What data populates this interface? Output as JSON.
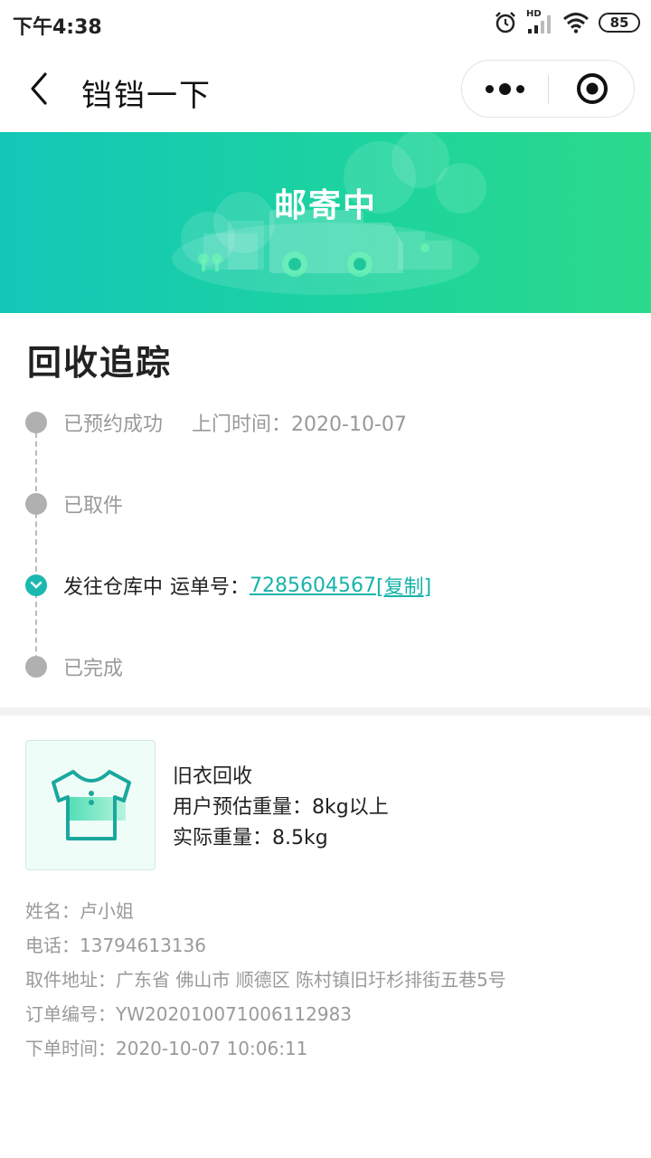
{
  "status": {
    "time": "下午4:38",
    "network": "HD",
    "battery": "85"
  },
  "nav": {
    "title": "铛铛一下"
  },
  "banner": {
    "title": "邮寄中"
  },
  "tracking": {
    "title": "回收追踪",
    "steps": [
      {
        "label": "已预约成功",
        "extra": "上门时间：2020-10-07"
      },
      {
        "label": "已取件"
      },
      {
        "label": "发往仓库中",
        "waybill_label": "运单号：",
        "waybill_number": "7285604567",
        "copy_label": "[复制]"
      },
      {
        "label": "已完成"
      }
    ]
  },
  "order": {
    "product_title": "旧衣回收",
    "estimated_weight": "用户预估重量：8kg以上",
    "actual_weight": "实际重量：8.5kg",
    "name": "姓名：卢小姐",
    "phone": "电话：13794613136",
    "address": "取件地址：广东省 佛山市 顺德区 陈村镇旧圩杉排街五巷5号",
    "order_no": "订单编号：YW202010071006112983",
    "order_time": "下单时间：2020-10-07 10:06:11"
  },
  "colors": {
    "accent": "#17b3aa",
    "banner_start": "#12c7b8",
    "banner_end": "#2bd98b"
  }
}
